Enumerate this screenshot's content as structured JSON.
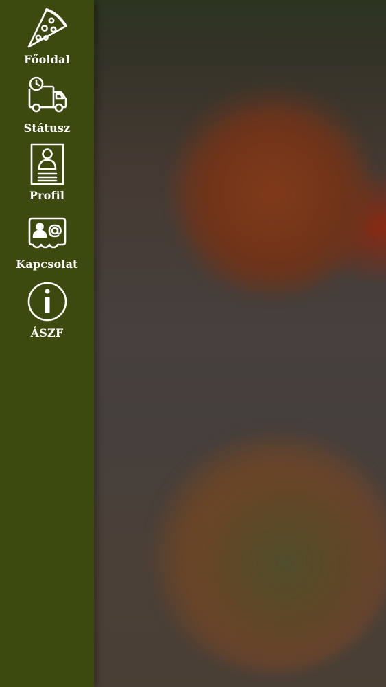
{
  "sidebar": {
    "background": "#3d4a0f",
    "items": [
      {
        "label": "Főoldal",
        "icon": "pizza-slice-icon"
      },
      {
        "label": "Státusz",
        "icon": "delivery-truck-clock-icon"
      },
      {
        "label": "Profil",
        "icon": "profile-card-icon"
      },
      {
        "label": "Kapcsolat",
        "icon": "contact-card-icon"
      },
      {
        "label": "ÁSZF",
        "icon": "info-circle-icon"
      }
    ]
  },
  "background": {
    "description_colors": {
      "overlay": "#45403d",
      "pizza_top": "#7a3a18",
      "pizza_bottom": "#6b4a26"
    }
  }
}
